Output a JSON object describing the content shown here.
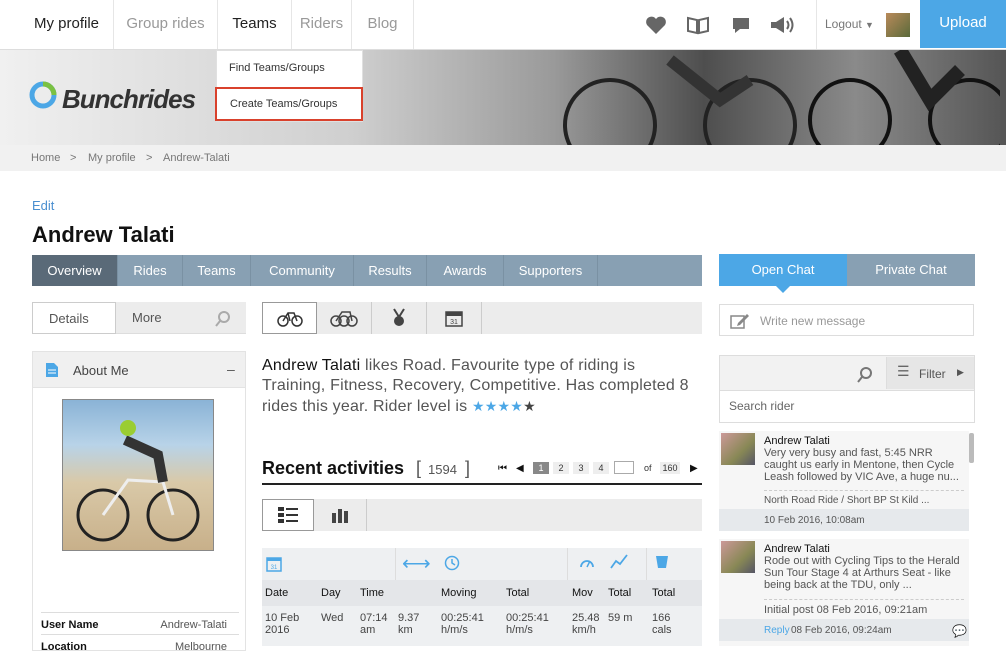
{
  "nav": {
    "items": [
      "My profile",
      "Group rides",
      "Teams",
      "Riders",
      "Blog"
    ],
    "logout": "Logout",
    "upload": "Upload"
  },
  "dropdown": {
    "find": "Find Teams/Groups",
    "create": "Create Teams/Groups"
  },
  "brand": {
    "logo_text": "Bunchrides"
  },
  "breadcrumb": [
    "Home",
    ">",
    "My profile",
    ">",
    "Andrew-Talati"
  ],
  "profile": {
    "edit": "Edit",
    "name": "Andrew Talati"
  },
  "tabs": [
    "Overview",
    "Rides",
    "Teams",
    "Community",
    "Results",
    "Awards",
    "Supporters"
  ],
  "chat_tabs": [
    "Open Chat",
    "Private Chat"
  ],
  "subtabs": [
    "Details",
    "More"
  ],
  "about": {
    "title": "About Me",
    "collapse": "–",
    "username_label": "User Name",
    "username_value": "Andrew-Talati",
    "location_label": "Location",
    "location_value": "Melbourne"
  },
  "blurb": {
    "name": "Andrew Talati",
    "text": "likes Road. Favourite type of riding is Training, Fitness, Recovery, Competitive. Has completed 8 rides this year. Rider level is",
    "rating": 4
  },
  "recent": {
    "title": "Recent activities",
    "bracket_open": "[",
    "count": "1594",
    "bracket_close": "]",
    "pages": [
      "1",
      "2",
      "3",
      "4"
    ],
    "of_label": "of",
    "total_pages": "160"
  },
  "table": {
    "headers": [
      "Date",
      "Day",
      "Time",
      "",
      "Moving",
      "Total",
      "Mov",
      "Total",
      "Total"
    ],
    "row": {
      "date": "10 Feb 2016",
      "day": "Wed",
      "time": "07:14 am",
      "distance": "9.37 km",
      "moving": "00:25:41 h/m/s",
      "total": "00:25:41 h/m/s",
      "speed": "25.48 km/h",
      "elev": "59 m",
      "cals": "166 cals"
    }
  },
  "chat": {
    "write_placeholder": "Write new message",
    "filter": "Filter",
    "search_placeholder": "Search rider",
    "posts": [
      {
        "name": "Andrew Talati",
        "text": "Very very busy and fast, 5:45 NRR caught us early in Mentone, then Cycle Leash followed by VIC Ave, a huge nu...",
        "route": "North Road Ride / Short BP St Kild ...",
        "date": "10 Feb 2016, 10:08am"
      },
      {
        "name": "Andrew Talati",
        "text": "Rode out with Cycling Tips to the Herald Sun Tour Stage 4 at Arthurs Seat - like being back at the TDU, only ...",
        "initial": "Initial post 08 Feb 2016, 09:21am",
        "reply": "Reply",
        "reply_date": "08 Feb 2016, 09:24am"
      }
    ]
  },
  "colors": {
    "accent": "#4ca7e6",
    "tabbar": "#88a0b3",
    "tab_active": "#5a6a78",
    "highlight": "#d9412c"
  }
}
